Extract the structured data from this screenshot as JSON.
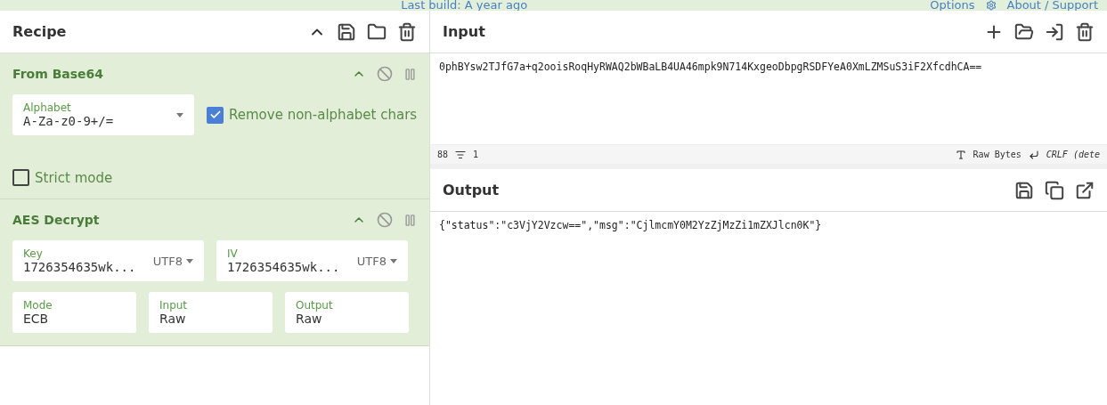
{
  "top_bar": {
    "build": "Last build: A year ago",
    "options": "Options",
    "about": "About / Support"
  },
  "recipe": {
    "title": "Recipe",
    "operations": [
      {
        "kind": "base64",
        "name": "From Base64",
        "alphabet": {
          "label": "Alphabet",
          "value": "A-Za-z0-9+/="
        },
        "remove": {
          "label": "Remove non-alphabet chars",
          "checked": true
        },
        "strict": {
          "label": "Strict mode",
          "checked": false
        }
      },
      {
        "kind": "aes",
        "name": "AES Decrypt",
        "key": {
          "label": "Key",
          "value": "1726354635wk...",
          "encoding": "UTF8"
        },
        "iv": {
          "label": "IV",
          "value": "1726354635wk...",
          "encoding": "UTF8"
        },
        "fields": [
          {
            "label": "Mode",
            "value": "ECB"
          },
          {
            "label": "Input",
            "value": "Raw"
          },
          {
            "label": "Output",
            "value": "Raw"
          }
        ]
      }
    ]
  },
  "input": {
    "title": "Input",
    "value": "0phBYsw2TJfG7a+q2ooisRoqHyRWAQ2bWBaLB4UA46mpk9N714KxgeoDbpgRSDFYeA0XmLZMSuS3iF2XfcdhCA==",
    "length": "88",
    "lines": "1",
    "encoding": "Raw Bytes",
    "eol": "CRLF (dete"
  },
  "output": {
    "title": "Output",
    "value": "{\"status\":\"c3VjY2Vzcw==\",\"msg\":\"CjlmcmY0M2YzZjMzZi1mZXJlcn0K\"}"
  }
}
